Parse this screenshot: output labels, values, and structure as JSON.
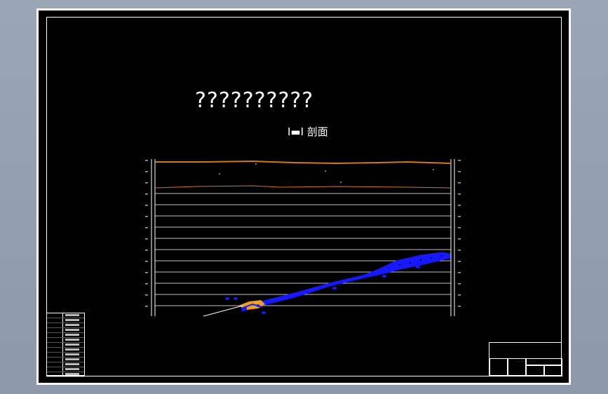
{
  "drawing": {
    "title": "??????????",
    "subtitle": "I▬I 剖面"
  },
  "colors": {
    "background": "#000000",
    "frame": "#ffffff",
    "ground_surface": "#d4781e",
    "seam": "#1818ff",
    "highlight": "#f0a020",
    "gridline": "#ffffff"
  },
  "title_block": {
    "label": "· · · · · · · ·"
  }
}
